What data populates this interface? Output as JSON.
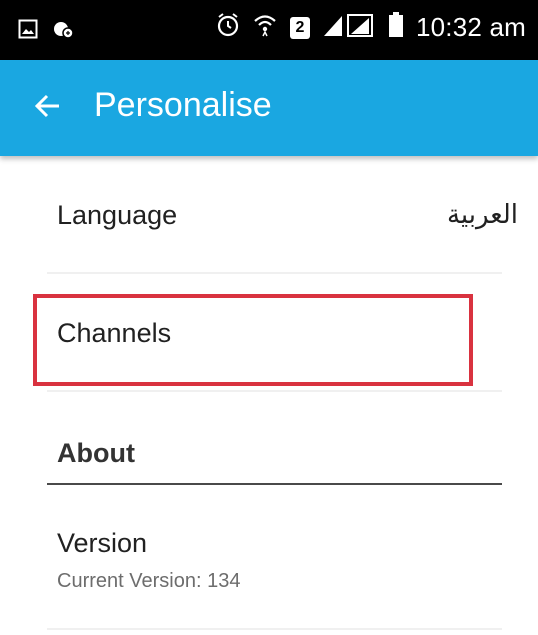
{
  "status_bar": {
    "time": "10:32 am",
    "sim_slot": "2",
    "icons": [
      "gallery-icon",
      "sync-app-icon",
      "alarm-icon",
      "wifi-icon",
      "signal-icon",
      "battery-icon"
    ]
  },
  "app_bar": {
    "title": "Personalise",
    "back_icon": "arrow-left-icon",
    "color": "#1aa7e1"
  },
  "settings": {
    "language": {
      "label": "Language",
      "value": "العربية"
    },
    "channels": {
      "label": "Channels"
    },
    "about": {
      "header": "About"
    },
    "version": {
      "label": "Version",
      "subtext": "Current Version: 134"
    }
  },
  "highlight": {
    "target": "channels",
    "color": "#d9323f"
  }
}
